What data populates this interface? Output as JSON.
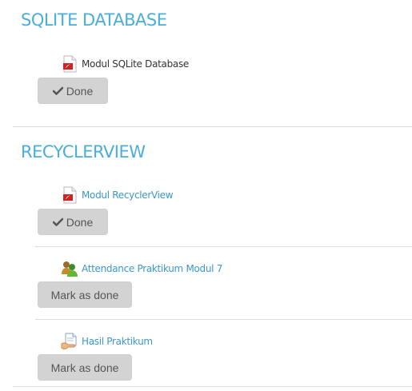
{
  "sections": [
    {
      "title": "SQLITE DATABASE",
      "activities": [
        {
          "name": "Modul SQLite Database",
          "icon": "pdf-icon",
          "button": {
            "label": "Done",
            "icon": "check-icon"
          }
        }
      ]
    },
    {
      "title": "RECYCLERVIEW",
      "activities": [
        {
          "name": "Modul RecyclerView",
          "icon": "pdf-icon",
          "button": {
            "label": "Done",
            "icon": "check-icon"
          }
        },
        {
          "name": "Attendance Praktikum Modul 7",
          "icon": "attendance-icon",
          "button": {
            "label": "Mark as done"
          }
        },
        {
          "name": "Hasil Praktikum",
          "icon": "assignment-icon",
          "button": {
            "label": "Mark as done"
          }
        }
      ]
    }
  ],
  "colors": {
    "section_title": "#4aaed9",
    "link": "#3a98c9",
    "button_bg": "#d3d3d3",
    "button_text": "#555555",
    "divider": "#dddddd"
  }
}
